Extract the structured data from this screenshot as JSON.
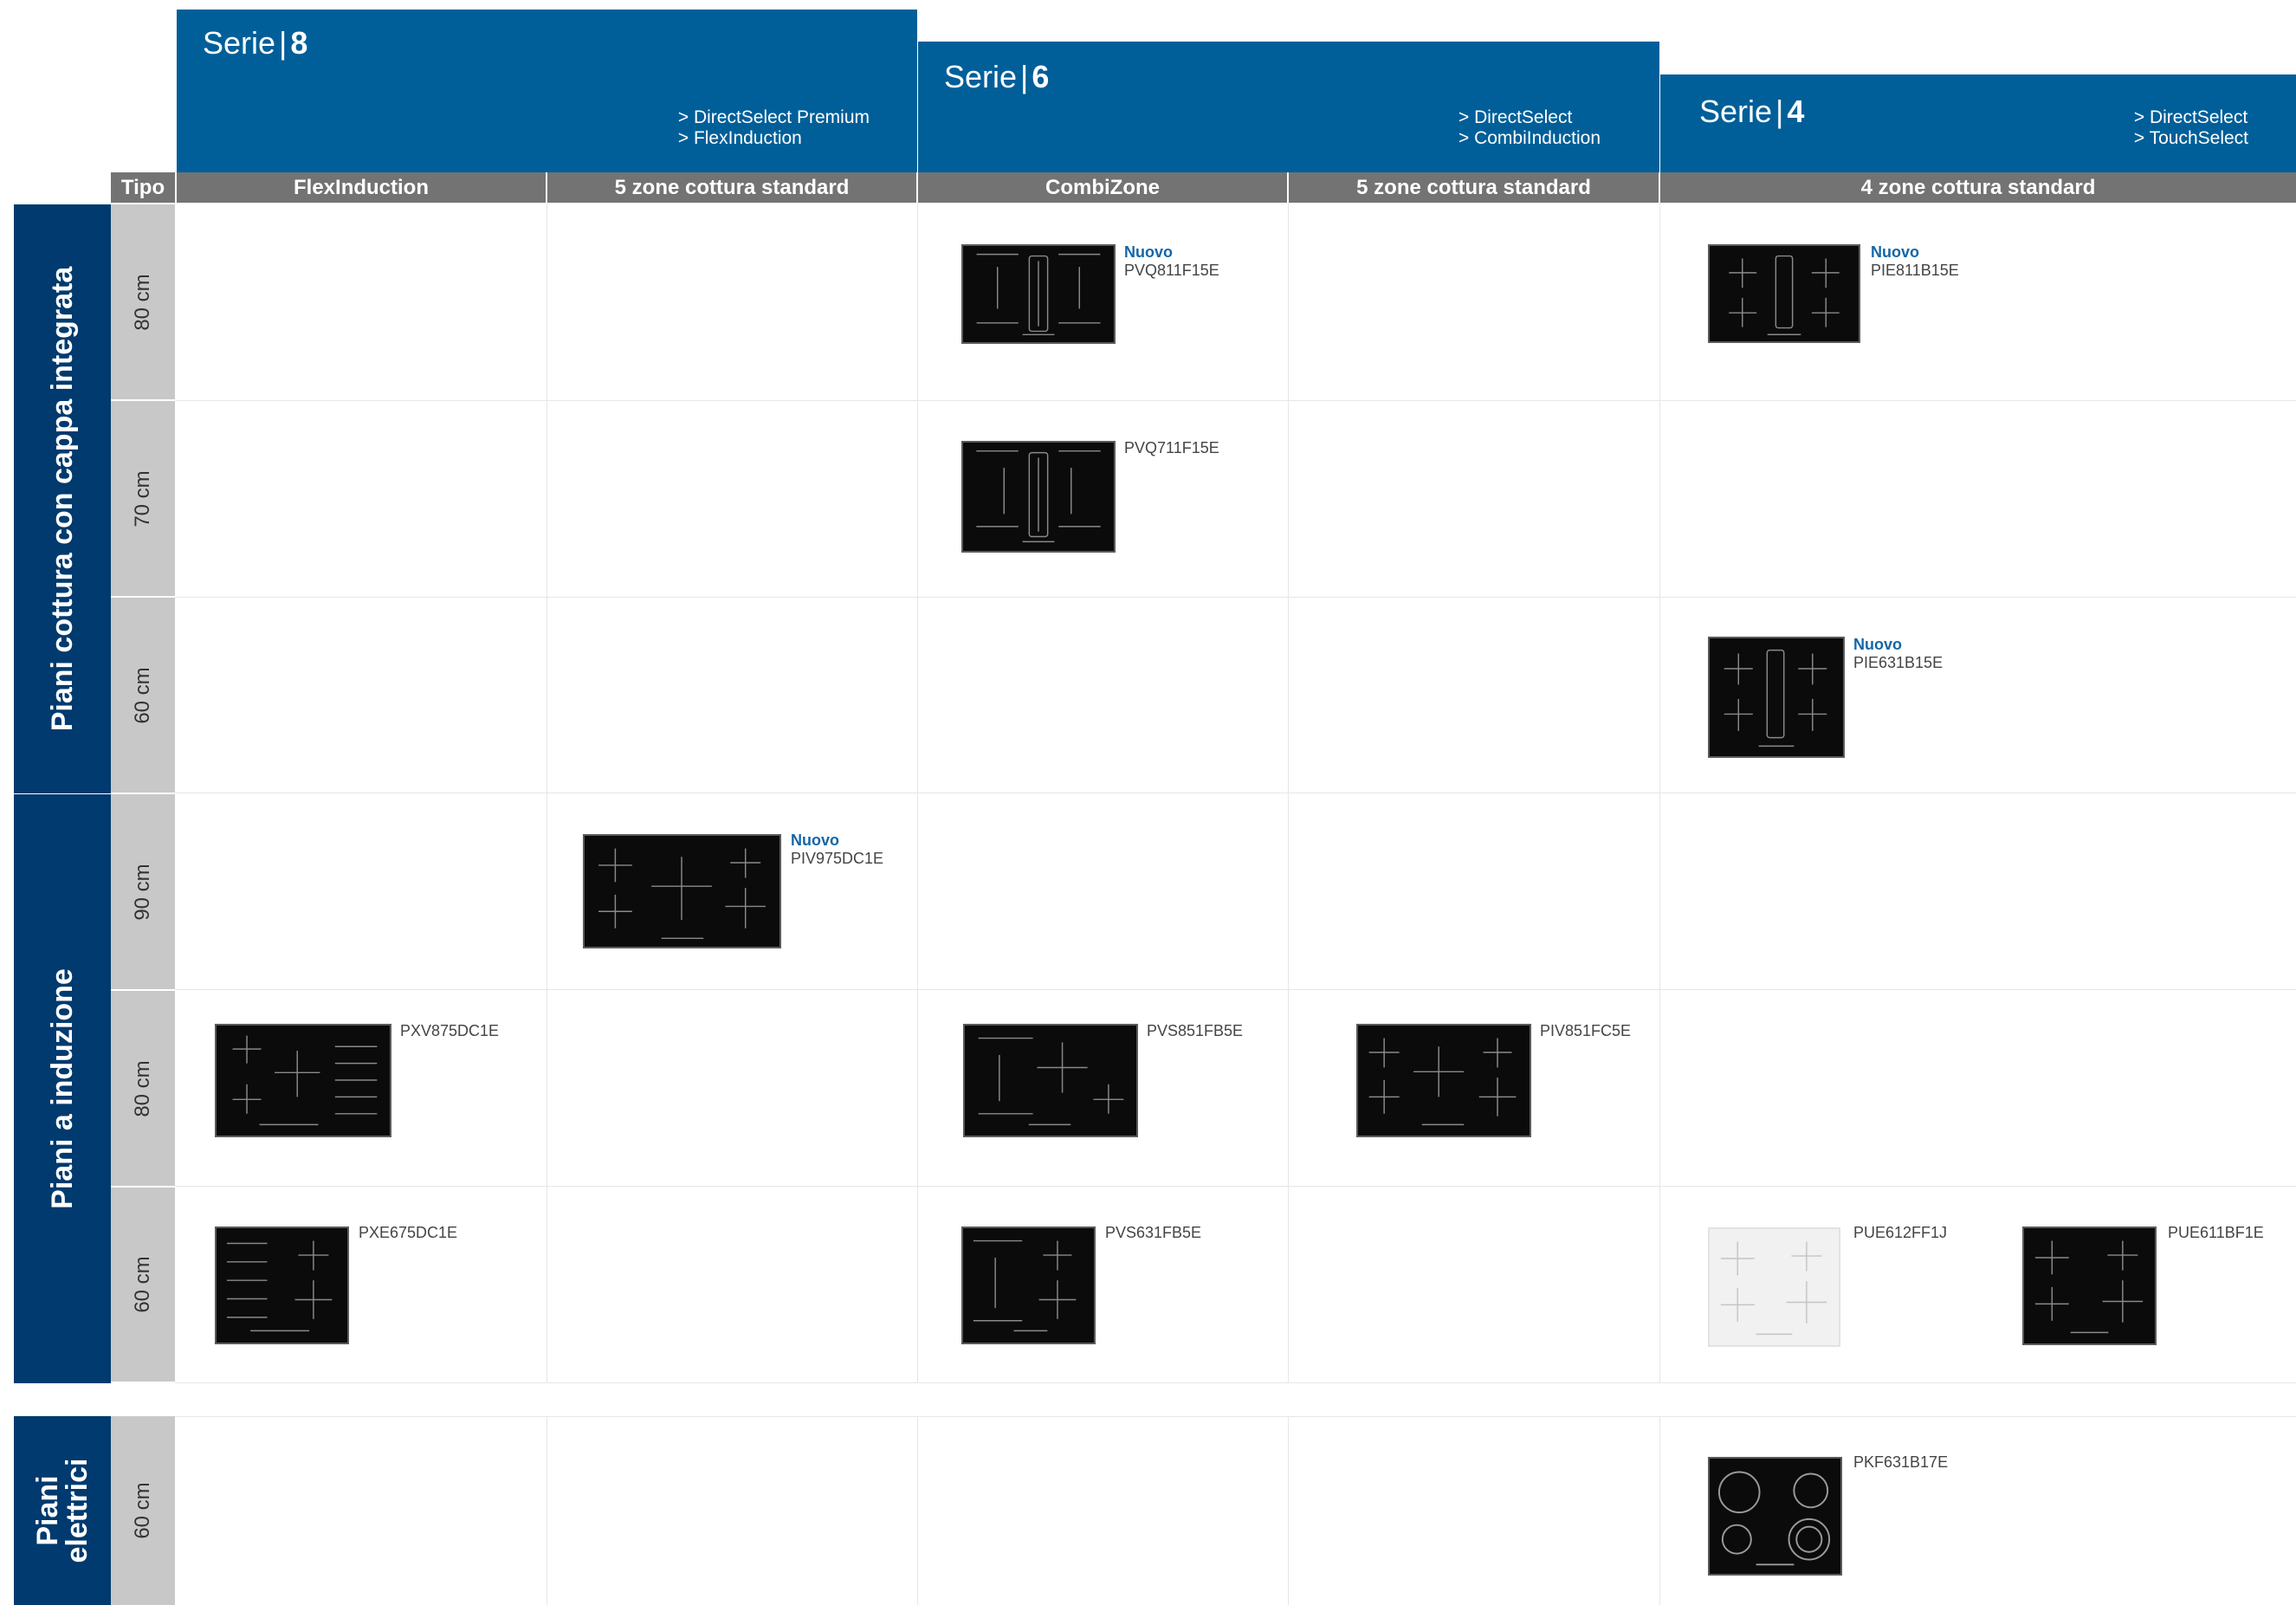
{
  "series": [
    {
      "prefix": "Serie",
      "sep": "|",
      "number": "8",
      "features": [
        "> DirectSelect Premium",
        "> FlexInduction"
      ]
    },
    {
      "prefix": "Serie",
      "sep": "|",
      "number": "6",
      "features": [
        "> DirectSelect",
        "> CombiInduction"
      ]
    },
    {
      "prefix": "Serie",
      "sep": "|",
      "number": "4",
      "features": [
        "> DirectSelect",
        "> TouchSelect"
      ]
    }
  ],
  "header": {
    "tipo": "Tipo",
    "columns": [
      "FlexInduction",
      "5 zone cottura standard",
      "CombiZone",
      "5 zone cottura standard",
      "4 zone cottura standard"
    ]
  },
  "categories": [
    {
      "label": "Piani cottura con cappa integrata",
      "sizes": [
        "80 cm",
        "70 cm",
        "60 cm"
      ]
    },
    {
      "label": "Piani a induzione",
      "sizes": [
        "90 cm",
        "80 cm",
        "60 cm"
      ]
    },
    {
      "label": "Piani elettrici",
      "label_lines": [
        "Piani",
        "elettrici"
      ],
      "sizes": [
        "60 cm"
      ]
    }
  ],
  "new_label": "Nuovo",
  "products": [
    {
      "code": "PVQ811F15E",
      "new": true,
      "icon": "hob-venting-icon"
    },
    {
      "code": "PIE811B15E",
      "new": true,
      "icon": "hob-venting-icon"
    },
    {
      "code": "PVQ711F15E",
      "new": false,
      "icon": "hob-venting-icon"
    },
    {
      "code": "PIE631B15E",
      "new": true,
      "icon": "hob-venting-icon"
    },
    {
      "code": "PIV975DC1E",
      "new": true,
      "icon": "hob-induction-icon"
    },
    {
      "code": "PXV875DC1E",
      "new": false,
      "icon": "hob-flex-icon"
    },
    {
      "code": "PVS851FB5E",
      "new": false,
      "icon": "hob-combi-icon"
    },
    {
      "code": "PIV851FC5E",
      "new": false,
      "icon": "hob-induction-icon"
    },
    {
      "code": "PXE675DC1E",
      "new": false,
      "icon": "hob-flex-icon"
    },
    {
      "code": "PVS631FB5E",
      "new": false,
      "icon": "hob-combi-icon"
    },
    {
      "code": "PUE612FF1J",
      "new": false,
      "icon": "hob-induction-white-icon"
    },
    {
      "code": "PUE611BF1E",
      "new": false,
      "icon": "hob-induction-icon"
    },
    {
      "code": "PKF631B17E",
      "new": false,
      "icon": "hob-radiant-icon"
    }
  ],
  "colors": {
    "series_blue": "#005f99",
    "category_blue": "#003a6e",
    "header_grey": "#737373",
    "size_grey": "#c8c8c8",
    "new_blue": "#1466a8"
  }
}
